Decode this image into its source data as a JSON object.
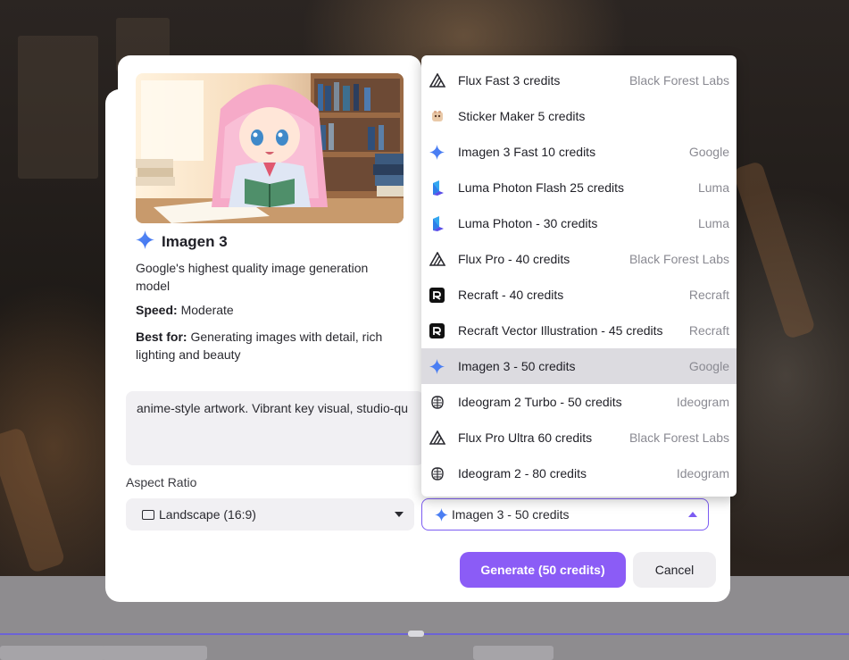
{
  "model_card": {
    "title": "Imagen 3",
    "icon": "google-sparkle-icon",
    "description": "Google's highest quality image generation model",
    "speed_label": "Speed:",
    "speed_value": "Moderate",
    "best_for_label": "Best for:",
    "best_for_value": "Generating images with detail, rich lighting and beauty"
  },
  "prompt": {
    "value": "anime-style artwork. Vibrant key visual, studio-qu"
  },
  "aspect_ratio": {
    "label": "Aspect Ratio",
    "selected": "Landscape (16:9)"
  },
  "model_select": {
    "selected": "Imagen 3 - 50 credits"
  },
  "dropdown": {
    "options": [
      {
        "label": "Flux Fast 3 credits",
        "provider": "Black Forest Labs",
        "icon": "flux-icon"
      },
      {
        "label": "Sticker Maker 5 credits",
        "provider": "",
        "icon": "sticker-icon"
      },
      {
        "label": "Imagen 3 Fast 10 credits",
        "provider": "Google",
        "icon": "google-sparkle-icon"
      },
      {
        "label": "Luma Photon Flash 25 credits",
        "provider": "Luma",
        "icon": "luma-icon"
      },
      {
        "label": "Luma Photon - 30 credits",
        "provider": "Luma",
        "icon": "luma-icon"
      },
      {
        "label": "Flux Pro - 40 credits",
        "provider": "Black Forest Labs",
        "icon": "flux-icon"
      },
      {
        "label": "Recraft - 40 credits",
        "provider": "Recraft",
        "icon": "recraft-icon"
      },
      {
        "label": "Recraft Vector Illustration - 45 credits",
        "provider": "Recraft",
        "icon": "recraft-icon"
      },
      {
        "label": "Imagen 3 - 50 credits",
        "provider": "Google",
        "icon": "google-sparkle-icon",
        "selected": true
      },
      {
        "label": "Ideogram 2 Turbo - 50 credits",
        "provider": "Ideogram",
        "icon": "ideogram-icon"
      },
      {
        "label": "Flux Pro Ultra 60 credits",
        "provider": "Black Forest Labs",
        "icon": "flux-icon"
      },
      {
        "label": "Ideogram 2 - 80 credits",
        "provider": "Ideogram",
        "icon": "ideogram-icon"
      }
    ]
  },
  "buttons": {
    "generate": "Generate (50 credits)",
    "cancel": "Cancel"
  },
  "colors": {
    "accent": "#8b5cf6",
    "google_blue": "#4285f4"
  }
}
